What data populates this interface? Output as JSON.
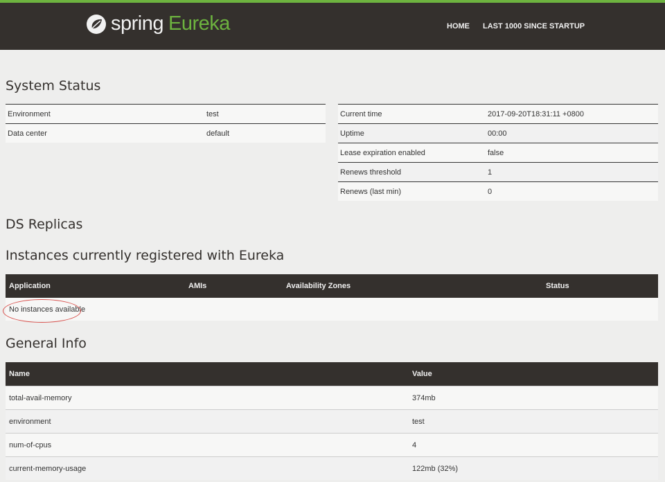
{
  "nav": {
    "logo_spring": "spring",
    "logo_eureka": "Eureka",
    "home": "HOME",
    "last1000": "LAST 1000 SINCE STARTUP",
    "brand_color": "#6db33f",
    "bar_color": "#34302d"
  },
  "system_status": {
    "title": "System Status",
    "left": [
      {
        "key": "Environment",
        "value": "test"
      },
      {
        "key": "Data center",
        "value": "default"
      }
    ],
    "right": [
      {
        "key": "Current time",
        "value": "2017-09-20T18:31:11 +0800"
      },
      {
        "key": "Uptime",
        "value": "00:00"
      },
      {
        "key": "Lease expiration enabled",
        "value": "false"
      },
      {
        "key": "Renews threshold",
        "value": "1"
      },
      {
        "key": "Renews (last min)",
        "value": "0"
      }
    ]
  },
  "ds_replicas": {
    "title": "DS Replicas"
  },
  "instances": {
    "title": "Instances currently registered with Eureka",
    "headers": [
      "Application",
      "AMIs",
      "Availability Zones",
      "Status"
    ],
    "empty_text": "No instances available"
  },
  "general_info": {
    "title": "General Info",
    "headers": [
      "Name",
      "Value"
    ],
    "rows": [
      {
        "name": "total-avail-memory",
        "value": "374mb"
      },
      {
        "name": "environment",
        "value": "test"
      },
      {
        "name": "num-of-cpus",
        "value": "4"
      },
      {
        "name": "current-memory-usage",
        "value": "122mb (32%)"
      }
    ]
  }
}
